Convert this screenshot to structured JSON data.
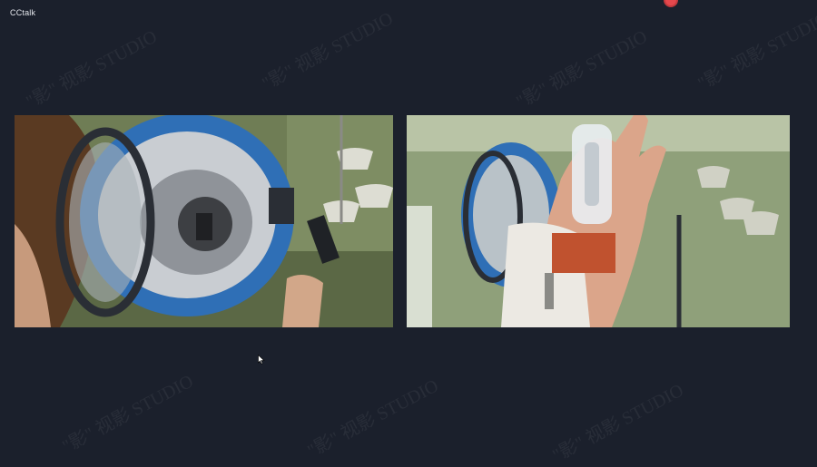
{
  "app": {
    "title": "CCtalk"
  },
  "watermark": {
    "text": "\"影\" 视影 STUDIO"
  },
  "videos": [
    {
      "name": "left-video",
      "subject": "light-fixture-reflector"
    },
    {
      "name": "right-video",
      "subject": "lamp-bulb-in-hand"
    }
  ],
  "colors": {
    "background": "#1b202c",
    "recording": "#e5484d"
  },
  "icons": {
    "cursor": "cursor-icon",
    "record": "record-indicator-icon"
  }
}
